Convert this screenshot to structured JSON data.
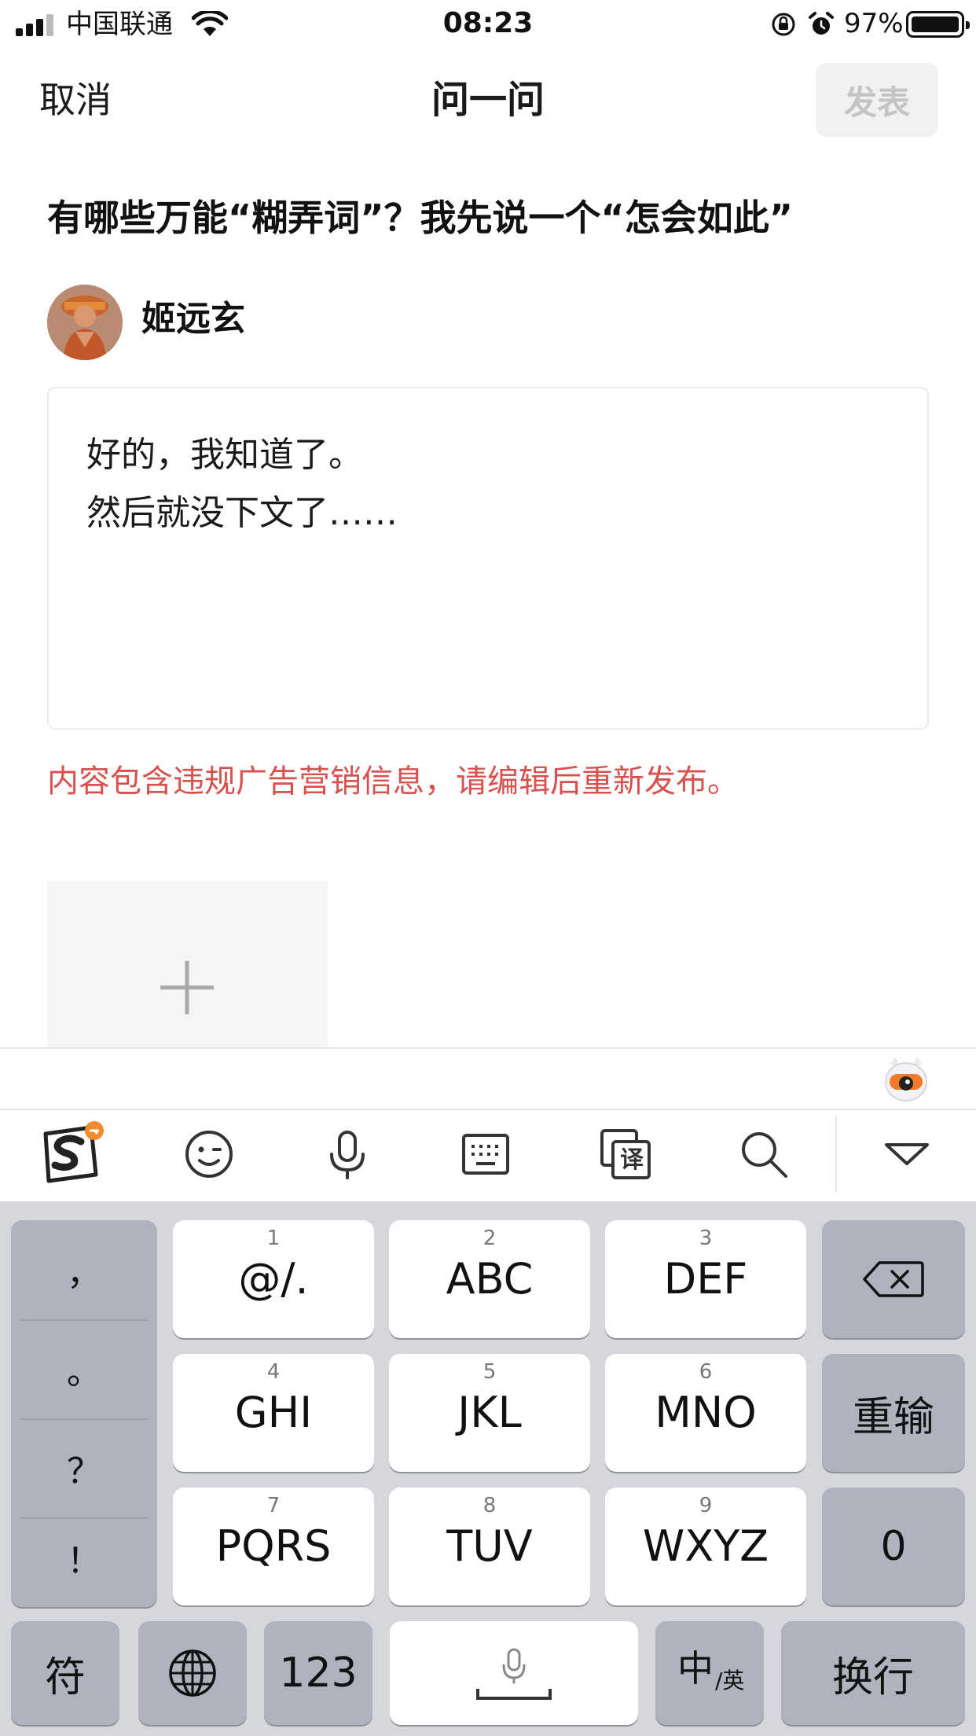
{
  "status_bar": {
    "carrier": "中国联通",
    "time": "08:23",
    "battery_percent": "97%",
    "signal_bars": 3,
    "battery_level": 0.97
  },
  "nav": {
    "cancel": "取消",
    "title": "问一问",
    "publish": "发表"
  },
  "question": {
    "text": "有哪些万能“糊弄词”？我先说一个“怎会如此”"
  },
  "user": {
    "name": "姬远玄"
  },
  "answer": {
    "lines": [
      "好的，我知道了。",
      "然后就没下文了……"
    ]
  },
  "warning": "内容包含违规广告营销信息，请编辑后重新发布。",
  "keyboard": {
    "toolbar": [
      "sogou-logo-icon",
      "emoji-icon",
      "microphone-icon",
      "keyboard-icon",
      "translate-icon",
      "search-icon",
      "collapse-keyboard-icon"
    ],
    "punctuation": [
      "，",
      "。",
      "？",
      "！"
    ],
    "keys": [
      {
        "num": "1",
        "letters": "@/."
      },
      {
        "num": "2",
        "letters": "ABC"
      },
      {
        "num": "3",
        "letters": "DEF"
      },
      {
        "num": "4",
        "letters": "GHI"
      },
      {
        "num": "5",
        "letters": "JKL"
      },
      {
        "num": "6",
        "letters": "MNO"
      },
      {
        "num": "7",
        "letters": "PQRS"
      },
      {
        "num": "8",
        "letters": "TUV"
      },
      {
        "num": "9",
        "letters": "WXYZ"
      }
    ],
    "reenter": "重输",
    "zero": "0",
    "symbols": "符",
    "num123": "123",
    "lang_main": "中",
    "lang_sub": "/英",
    "newline": "换行",
    "translate_glyph": "译"
  },
  "colors": {
    "warning": "#d8514e",
    "keyboard_bg": "#d5d7dc",
    "dark_key": "#aeb3bd",
    "publish_disabled_bg": "#f1f1f1"
  }
}
